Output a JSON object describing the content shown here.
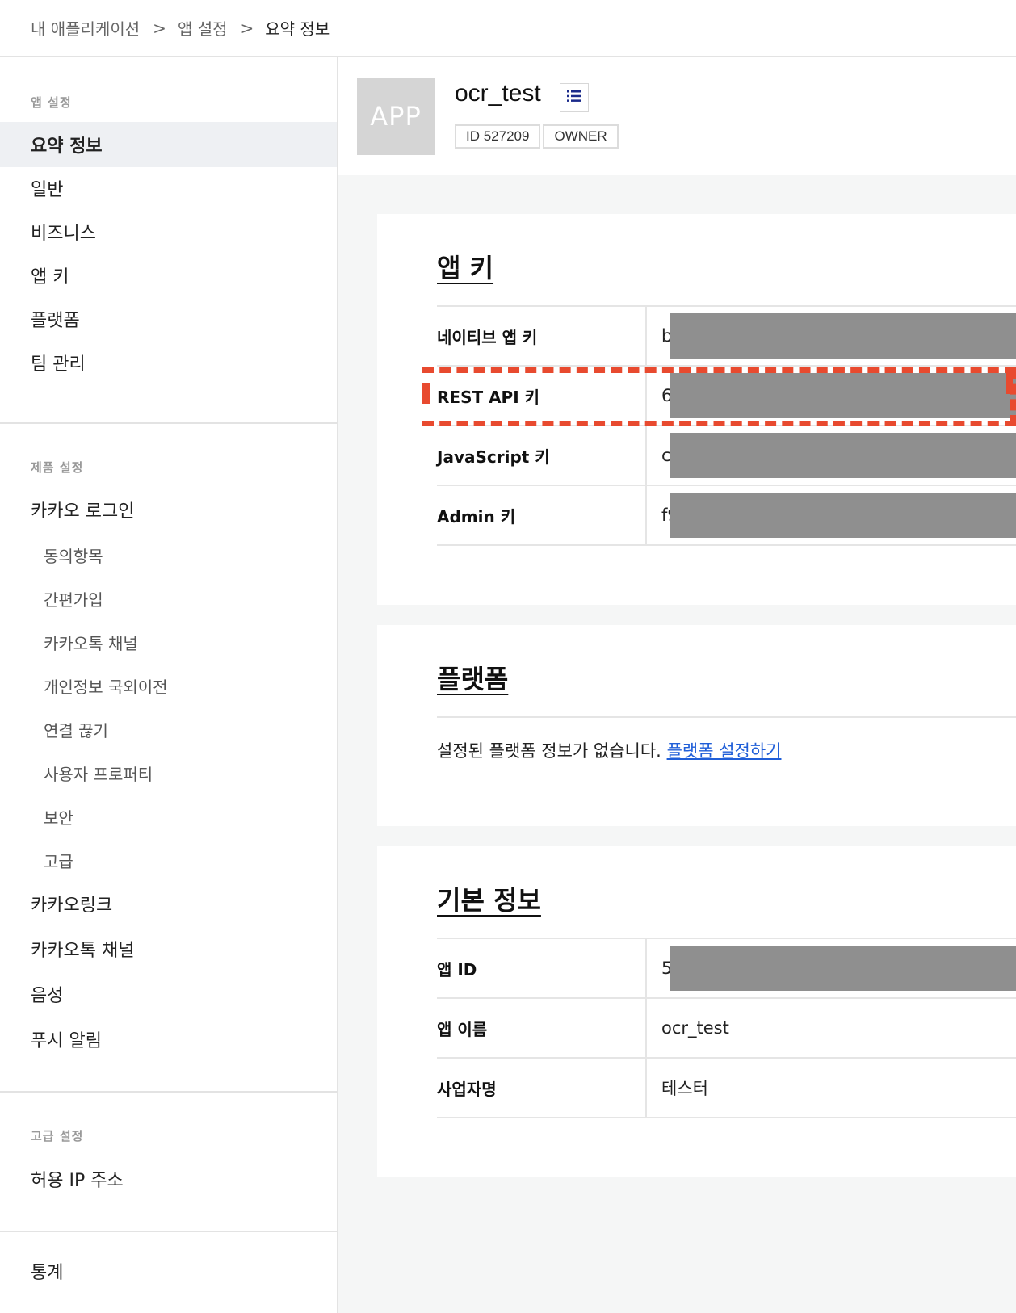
{
  "breadcrumb": {
    "items": [
      "내 애플리케이션",
      "앱 설정",
      "요약 정보"
    ],
    "separator": ">"
  },
  "sidebar": {
    "sections": [
      {
        "heading": "앱 설정",
        "items": [
          {
            "label": "요약 정보",
            "active": true
          },
          {
            "label": "일반"
          },
          {
            "label": "비즈니스"
          },
          {
            "label": "앱 키"
          },
          {
            "label": "플랫폼"
          },
          {
            "label": "팀 관리"
          }
        ]
      },
      {
        "heading": "제품 설정",
        "items": [
          {
            "label": "카카오 로그인"
          },
          {
            "label": "동의항목",
            "sub": true
          },
          {
            "label": "간편가입",
            "sub": true
          },
          {
            "label": "카카오톡 채널",
            "sub": true
          },
          {
            "label": "개인정보 국외이전",
            "sub": true
          },
          {
            "label": "연결 끊기",
            "sub": true
          },
          {
            "label": "사용자 프로퍼티",
            "sub": true
          },
          {
            "label": "보안",
            "sub": true
          },
          {
            "label": "고급",
            "sub": true
          },
          {
            "label": "카카오링크"
          },
          {
            "label": "카카오톡 채널"
          },
          {
            "label": "음성"
          },
          {
            "label": "푸시 알림"
          }
        ]
      },
      {
        "heading": "고급 설정",
        "items": [
          {
            "label": "허용 IP 주소"
          }
        ]
      },
      {
        "heading": "",
        "items": [
          {
            "label": "통계"
          }
        ]
      }
    ]
  },
  "app": {
    "logo_text": "APP",
    "name": "ocr_test",
    "menu_icon": "list-icon",
    "badges": [
      "ID 527209",
      "OWNER"
    ]
  },
  "app_keys": {
    "title": "앱 키",
    "rows": [
      {
        "key": "네이티브 앱 키",
        "value": "b",
        "redacted": true
      },
      {
        "key": "REST API 키",
        "value": "6",
        "redacted": true,
        "highlighted": true
      },
      {
        "key": "JavaScript 키",
        "value": "c",
        "redacted": true
      },
      {
        "key": "Admin 키",
        "value": "f9",
        "redacted": true
      }
    ]
  },
  "platform": {
    "title": "플랫폼",
    "empty_text": "설정된 플랫폼 정보가 없습니다.",
    "link_text": "플랫폼 설정하기"
  },
  "basic_info": {
    "title": "기본 정보",
    "rows": [
      {
        "key": "앱 ID",
        "value": "5",
        "redacted": true
      },
      {
        "key": "앱 이름",
        "value": "ocr_test"
      },
      {
        "key": "사업자명",
        "value": "테스터"
      }
    ]
  },
  "colors": {
    "highlight": "#e84a2f",
    "link": "#1f5ed8",
    "redaction": "#8f8f8f",
    "active_bg": "#eef0f3",
    "icon": "#1a2a8a"
  }
}
